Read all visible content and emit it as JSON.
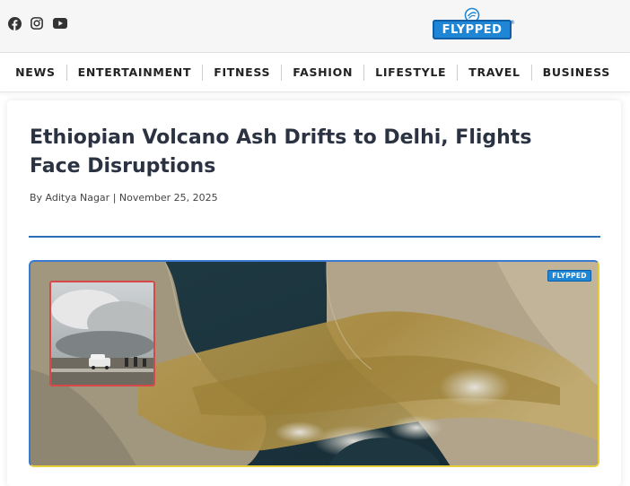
{
  "header": {
    "social": [
      {
        "icon": "facebook-icon"
      },
      {
        "icon": "instagram-icon"
      },
      {
        "icon": "youtube-icon"
      }
    ],
    "logo_text": "FLYPPED",
    "logo_reg": "®"
  },
  "nav": {
    "items": [
      "NEWS",
      "ENTERTAINMENT",
      "FITNESS",
      "FASHION",
      "LIFESTYLE",
      "TRAVEL",
      "BUSINESS"
    ]
  },
  "article": {
    "title": "Ethiopian Volcano Ash Drifts to Delhi, Flights Face Disruptions",
    "byline": "By Aditya Nagar | November 25, 2025",
    "image_logo_text": "FLYPPED"
  },
  "colors": {
    "accent": "#2c6db8",
    "logo_blue": "#1f86d6",
    "inset_border": "#d94848",
    "image_border_yellow": "#e8cf3a"
  }
}
